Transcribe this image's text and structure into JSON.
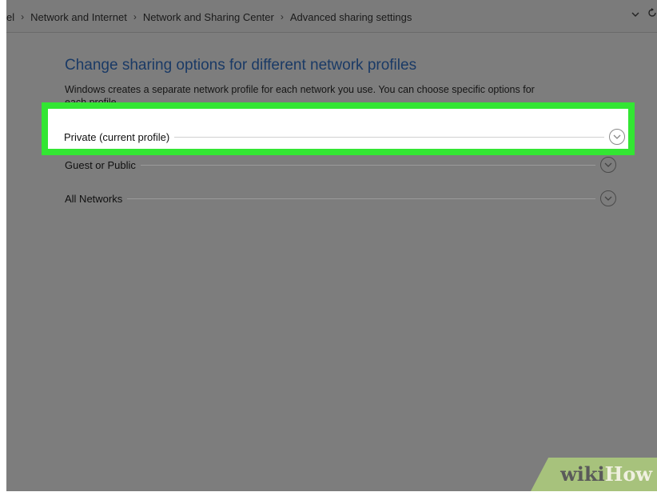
{
  "breadcrumb": {
    "items": [
      "Network and Internet",
      "Network and Sharing Center",
      "Advanced sharing settings"
    ],
    "leading_fragment": "el"
  },
  "page": {
    "title": "Change sharing options for different network profiles",
    "description": "Windows creates a separate network profile for each network you use. You can choose specific options for",
    "description_cont": "each profile."
  },
  "profiles": [
    {
      "label": "Private (current profile)"
    },
    {
      "label": "Guest or Public"
    },
    {
      "label": "All Networks"
    }
  ],
  "watermark": {
    "wiki": "wiki",
    "how": "How"
  },
  "colors": {
    "highlight_border": "#33e633",
    "title_blue": "#1a3a66",
    "dim_overlay": "#7d7d7d"
  }
}
